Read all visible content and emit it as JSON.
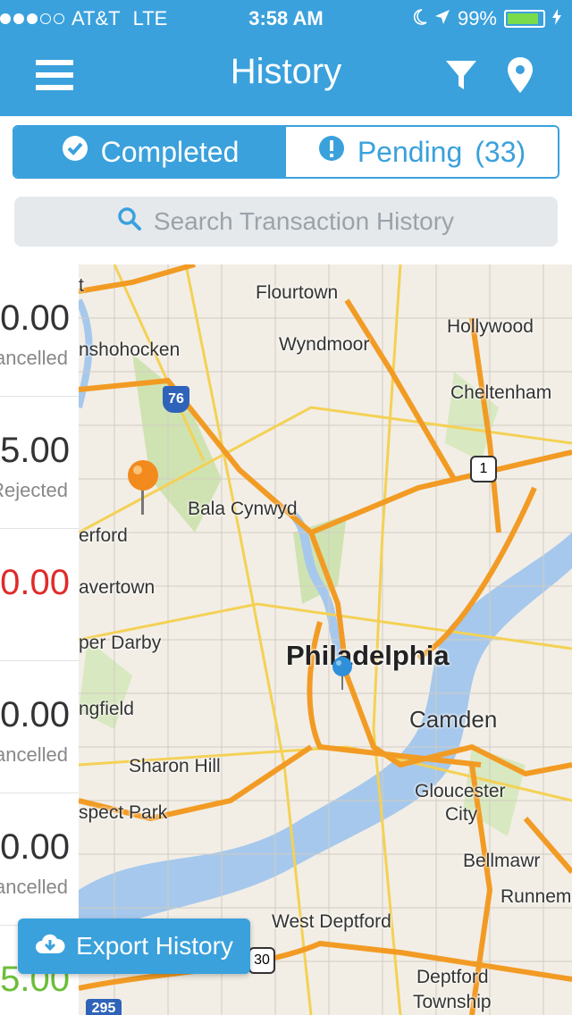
{
  "status_bar": {
    "carrier": "AT&T",
    "network": "LTE",
    "time": "3:58 AM",
    "battery": "99%",
    "battery_level": 0.99,
    "signal_bars_filled": 3,
    "signal_bars_total": 5
  },
  "header": {
    "title": "History",
    "menu_icon": "hamburger-icon",
    "filter_icon": "filter-icon",
    "location_icon": "map-pin-icon"
  },
  "segments": {
    "completed_label": "Completed",
    "pending_label": "Pending",
    "pending_count": "(33)"
  },
  "search": {
    "placeholder": "Search Transaction History"
  },
  "transactions": [
    {
      "amount": "0.00",
      "status": "ancelled"
    },
    {
      "amount": "5.00",
      "status": "Rejected"
    },
    {
      "amount": "0.00",
      "status": ""
    },
    {
      "amount": "0.00",
      "status": "ancelled"
    },
    {
      "amount": "0.00",
      "status": "ancelled"
    },
    {
      "amount": "5.00",
      "status": ""
    }
  ],
  "map": {
    "labels": [
      "t",
      "Flourtown",
      "Hollywood",
      "nshohocken",
      "Wyndmoor",
      "Cheltenham",
      "Bala Cynwyd",
      "erford",
      "avertown",
      "per Darby",
      "Philadelphia",
      "Camden",
      "ngfield",
      "Sharon Hill",
      "Gloucester",
      "City",
      "spect Park",
      "Bellmawr",
      "Runnem",
      "West Deptford",
      "Deptford",
      "Township"
    ],
    "shields": [
      "76",
      "1",
      "30",
      "295"
    ]
  },
  "export_button": {
    "label": "Export History"
  },
  "colors": {
    "brand_blue": "#3aa1dc",
    "rejected_red": "#e02b2b",
    "completed_green": "#6cbe3a"
  }
}
